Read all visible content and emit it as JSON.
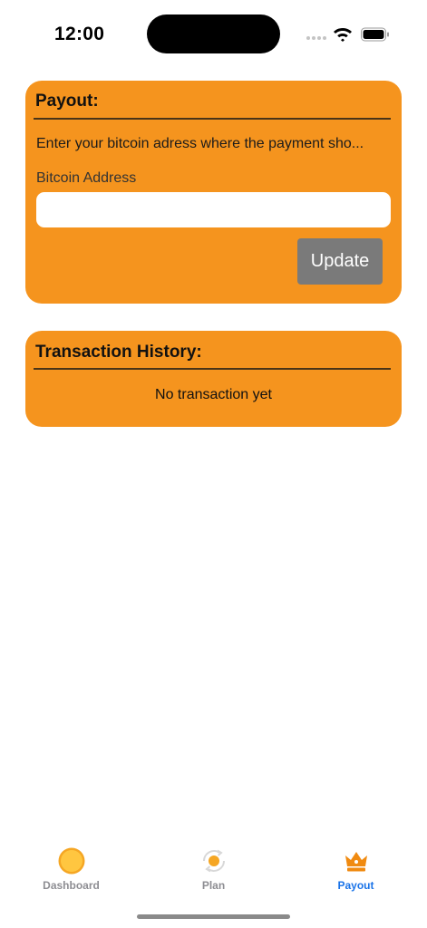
{
  "status_bar": {
    "time": "12:00"
  },
  "payout": {
    "title": "Payout:",
    "description": "Enter your bitcoin adress where the payment sho...",
    "field_label": "Bitcoin Address",
    "field_value": "",
    "update_label": "Update"
  },
  "history": {
    "title": "Transaction History:",
    "empty_text": "No transaction yet"
  },
  "tab_bar": {
    "tabs": [
      {
        "label": "Dashboard",
        "icon": "coin-icon",
        "active": false
      },
      {
        "label": "Plan",
        "icon": "refresh-coin-icon",
        "active": false
      },
      {
        "label": "Payout",
        "icon": "crown-icon",
        "active": true
      }
    ]
  },
  "colors": {
    "card": "#f5941e",
    "button": "#7a7a7a",
    "active_tab": "#1a73e8",
    "inactive_tab": "#8e8e93"
  }
}
